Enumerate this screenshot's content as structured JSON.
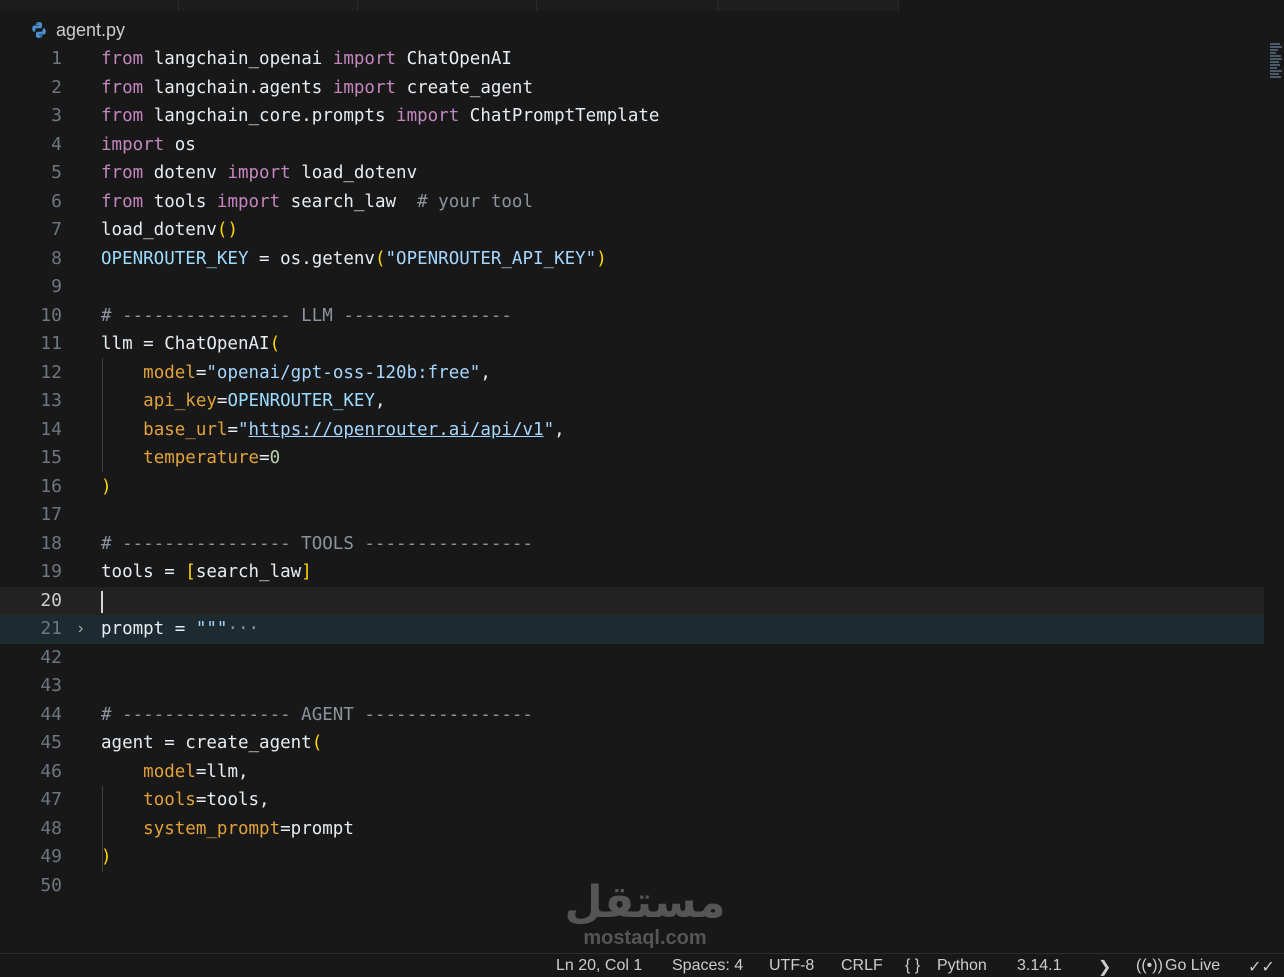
{
  "tab": {
    "filename": "agent.py"
  },
  "code_lines": [
    {
      "num": "1",
      "tokens": [
        [
          "k",
          "from"
        ],
        [
          "t",
          " langchain_openai "
        ],
        [
          "k",
          "import"
        ],
        [
          "t",
          " ChatOpenAI"
        ]
      ]
    },
    {
      "num": "2",
      "tokens": [
        [
          "k",
          "from"
        ],
        [
          "t",
          " langchain.agents "
        ],
        [
          "k",
          "import"
        ],
        [
          "t",
          " create_agent"
        ]
      ]
    },
    {
      "num": "3",
      "tokens": [
        [
          "k",
          "from"
        ],
        [
          "t",
          " langchain_core.prompts "
        ],
        [
          "k",
          "import"
        ],
        [
          "t",
          " ChatPromptTemplate"
        ]
      ]
    },
    {
      "num": "4",
      "tokens": [
        [
          "k",
          "import"
        ],
        [
          "t",
          " os"
        ]
      ]
    },
    {
      "num": "5",
      "tokens": [
        [
          "k",
          "from"
        ],
        [
          "t",
          " dotenv "
        ],
        [
          "k",
          "import"
        ],
        [
          "t",
          " load_dotenv"
        ]
      ]
    },
    {
      "num": "6",
      "tokens": [
        [
          "k",
          "from"
        ],
        [
          "t",
          " tools "
        ],
        [
          "k",
          "import"
        ],
        [
          "t",
          " search_law  "
        ],
        [
          "cm",
          "# your tool"
        ]
      ]
    },
    {
      "num": "7",
      "tokens": [
        [
          "t",
          "load_dotenv"
        ],
        [
          "p1",
          "()"
        ]
      ]
    },
    {
      "num": "8",
      "tokens": [
        [
          "v",
          "OPENROUTER_KEY"
        ],
        [
          "t",
          " = os.getenv"
        ],
        [
          "p1",
          "("
        ],
        [
          "str2",
          "\"OPENROUTER_API_KEY\""
        ],
        [
          "p1",
          ")"
        ]
      ]
    },
    {
      "num": "9",
      "tokens": []
    },
    {
      "num": "10",
      "tokens": [
        [
          "cm",
          "# ---------------- LLM ----------------"
        ]
      ]
    },
    {
      "num": "11",
      "tokens": [
        [
          "t",
          "llm = ChatOpenAI"
        ],
        [
          "p1",
          "("
        ]
      ]
    },
    {
      "num": "12",
      "tokens": [
        [
          "t",
          "    "
        ],
        [
          "kw",
          "model"
        ],
        [
          "t",
          "="
        ],
        [
          "str2",
          "\"openai/gpt-oss-120b:free\""
        ],
        [
          "t",
          ","
        ]
      ]
    },
    {
      "num": "13",
      "tokens": [
        [
          "t",
          "    "
        ],
        [
          "kw",
          "api_key"
        ],
        [
          "t",
          "="
        ],
        [
          "v",
          "OPENROUTER_KEY"
        ],
        [
          "t",
          ","
        ]
      ]
    },
    {
      "num": "14",
      "tokens": [
        [
          "t",
          "    "
        ],
        [
          "kw",
          "base_url"
        ],
        [
          "t",
          "="
        ],
        [
          "str2",
          "\""
        ],
        [
          "url",
          "https://openrouter.ai/api/v1"
        ],
        [
          "str2",
          "\""
        ],
        [
          "t",
          ","
        ]
      ]
    },
    {
      "num": "15",
      "tokens": [
        [
          "t",
          "    "
        ],
        [
          "kw",
          "temperature"
        ],
        [
          "t",
          "="
        ],
        [
          "num",
          "0"
        ]
      ]
    },
    {
      "num": "16",
      "tokens": [
        [
          "p1",
          ")"
        ]
      ]
    },
    {
      "num": "17",
      "tokens": []
    },
    {
      "num": "18",
      "tokens": [
        [
          "cm",
          "# ---------------- TOOLS ----------------"
        ]
      ]
    },
    {
      "num": "19",
      "tokens": [
        [
          "t",
          "tools = "
        ],
        [
          "p1",
          "["
        ],
        [
          "t",
          "search_law"
        ],
        [
          "p1",
          "]"
        ]
      ]
    },
    {
      "num": "20",
      "tokens": []
    },
    {
      "num": "21",
      "tokens": [
        [
          "t",
          "prompt = "
        ],
        [
          "str2",
          "\"\"\""
        ],
        [
          "el",
          "···"
        ]
      ]
    },
    {
      "num": "42",
      "tokens": []
    },
    {
      "num": "43",
      "tokens": []
    },
    {
      "num": "44",
      "tokens": [
        [
          "cm",
          "# ---------------- AGENT ----------------"
        ]
      ]
    },
    {
      "num": "45",
      "tokens": [
        [
          "t",
          "agent = create_agent"
        ],
        [
          "p1",
          "("
        ]
      ]
    },
    {
      "num": "46",
      "tokens": [
        [
          "t",
          "    "
        ],
        [
          "kw",
          "model"
        ],
        [
          "t",
          "=llm,"
        ]
      ]
    },
    {
      "num": "47",
      "tokens": [
        [
          "t",
          "    "
        ],
        [
          "kw",
          "tools"
        ],
        [
          "t",
          "=tools,"
        ]
      ]
    },
    {
      "num": "48",
      "tokens": [
        [
          "t",
          "    "
        ],
        [
          "kw",
          "system_prompt"
        ],
        [
          "t",
          "=prompt"
        ]
      ]
    },
    {
      "num": "49",
      "tokens": [
        [
          "p1",
          ")"
        ]
      ]
    },
    {
      "num": "50",
      "tokens": []
    }
  ],
  "status": {
    "position": "Ln 20, Col 1",
    "spaces": "Spaces: 4",
    "encoding": "UTF-8",
    "eol": "CRLF",
    "language_braces": "{ }",
    "language": "Python",
    "version": "3.14.1",
    "golive": "Go Live"
  },
  "watermark": {
    "logo": "مستقل",
    "site": "mostaql.com"
  },
  "colors": {
    "keyword": "#c586c0",
    "string": "#a5d6ff",
    "comment": "#8b949e",
    "variable": "#9cdcfe",
    "param": "#e2a23b",
    "bracket": "#ffd700"
  }
}
